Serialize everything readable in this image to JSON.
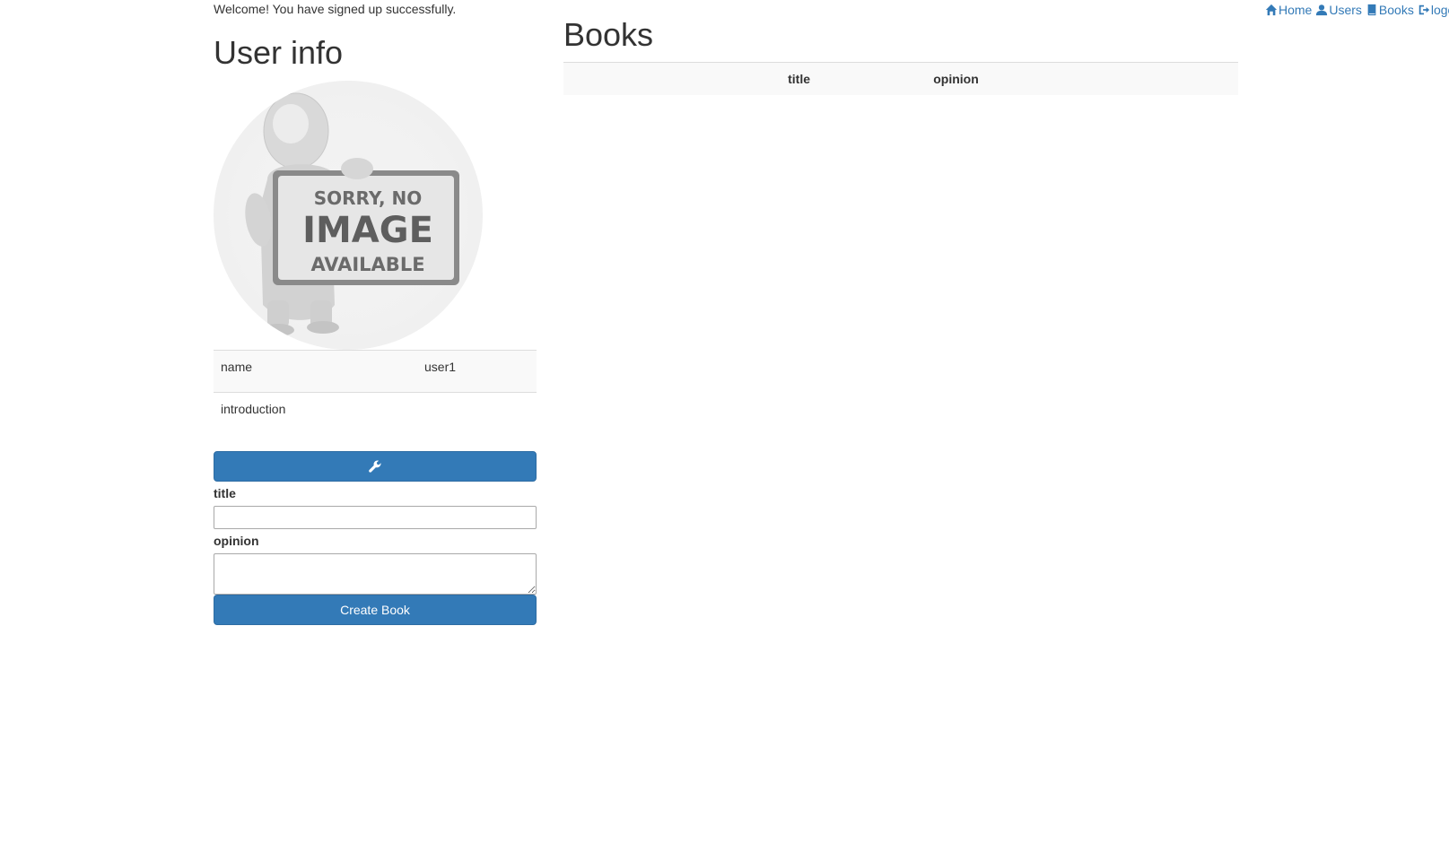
{
  "nav": {
    "home": "Home",
    "users": "Users",
    "books": "Books",
    "logout": "logout"
  },
  "flash": "Welcome! You have signed up successfully.",
  "user_info": {
    "title": "User info",
    "image_text": {
      "line1": "SORRY, NO",
      "line2": "IMAGE",
      "line3": "AVAILABLE"
    },
    "rows": [
      {
        "key": "name",
        "value": "user1"
      },
      {
        "key": "introduction",
        "value": ""
      }
    ],
    "edit_icon": "wrench-icon"
  },
  "book_form": {
    "title_label": "title",
    "title_value": "",
    "opinion_label": "opinion",
    "opinion_value": "",
    "submit_label": "Create Book"
  },
  "books": {
    "title": "Books",
    "columns": [
      "",
      "title",
      "opinion",
      ""
    ]
  },
  "colors": {
    "primary": "#337ab7",
    "link": "#337ab7",
    "text": "#333333"
  }
}
